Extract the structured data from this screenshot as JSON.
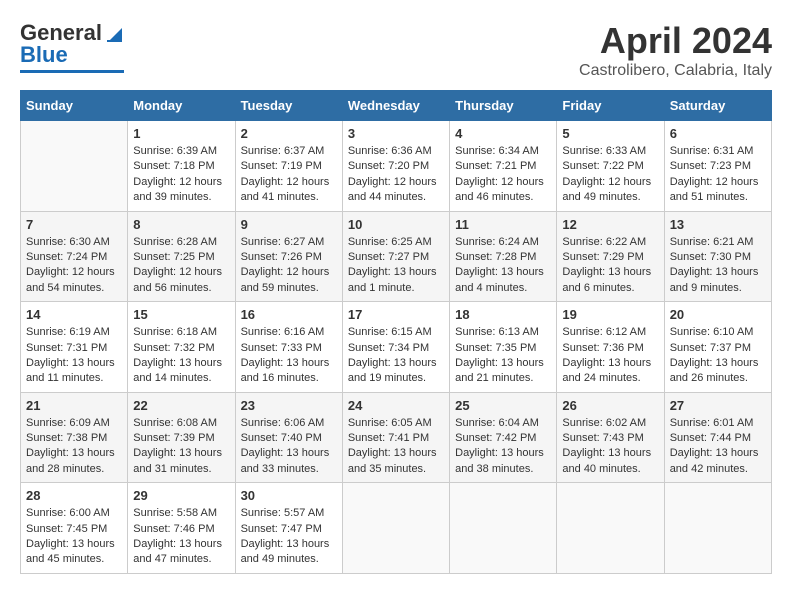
{
  "logo": {
    "part1": "General",
    "part2": "Blue"
  },
  "title": "April 2024",
  "subtitle": "Castrolibero, Calabria, Italy",
  "days_of_week": [
    "Sunday",
    "Monday",
    "Tuesday",
    "Wednesday",
    "Thursday",
    "Friday",
    "Saturday"
  ],
  "weeks": [
    [
      {
        "day": "",
        "info": ""
      },
      {
        "day": "1",
        "info": "Sunrise: 6:39 AM\nSunset: 7:18 PM\nDaylight: 12 hours\nand 39 minutes."
      },
      {
        "day": "2",
        "info": "Sunrise: 6:37 AM\nSunset: 7:19 PM\nDaylight: 12 hours\nand 41 minutes."
      },
      {
        "day": "3",
        "info": "Sunrise: 6:36 AM\nSunset: 7:20 PM\nDaylight: 12 hours\nand 44 minutes."
      },
      {
        "day": "4",
        "info": "Sunrise: 6:34 AM\nSunset: 7:21 PM\nDaylight: 12 hours\nand 46 minutes."
      },
      {
        "day": "5",
        "info": "Sunrise: 6:33 AM\nSunset: 7:22 PM\nDaylight: 12 hours\nand 49 minutes."
      },
      {
        "day": "6",
        "info": "Sunrise: 6:31 AM\nSunset: 7:23 PM\nDaylight: 12 hours\nand 51 minutes."
      }
    ],
    [
      {
        "day": "7",
        "info": "Sunrise: 6:30 AM\nSunset: 7:24 PM\nDaylight: 12 hours\nand 54 minutes."
      },
      {
        "day": "8",
        "info": "Sunrise: 6:28 AM\nSunset: 7:25 PM\nDaylight: 12 hours\nand 56 minutes."
      },
      {
        "day": "9",
        "info": "Sunrise: 6:27 AM\nSunset: 7:26 PM\nDaylight: 12 hours\nand 59 minutes."
      },
      {
        "day": "10",
        "info": "Sunrise: 6:25 AM\nSunset: 7:27 PM\nDaylight: 13 hours\nand 1 minute."
      },
      {
        "day": "11",
        "info": "Sunrise: 6:24 AM\nSunset: 7:28 PM\nDaylight: 13 hours\nand 4 minutes."
      },
      {
        "day": "12",
        "info": "Sunrise: 6:22 AM\nSunset: 7:29 PM\nDaylight: 13 hours\nand 6 minutes."
      },
      {
        "day": "13",
        "info": "Sunrise: 6:21 AM\nSunset: 7:30 PM\nDaylight: 13 hours\nand 9 minutes."
      }
    ],
    [
      {
        "day": "14",
        "info": "Sunrise: 6:19 AM\nSunset: 7:31 PM\nDaylight: 13 hours\nand 11 minutes."
      },
      {
        "day": "15",
        "info": "Sunrise: 6:18 AM\nSunset: 7:32 PM\nDaylight: 13 hours\nand 14 minutes."
      },
      {
        "day": "16",
        "info": "Sunrise: 6:16 AM\nSunset: 7:33 PM\nDaylight: 13 hours\nand 16 minutes."
      },
      {
        "day": "17",
        "info": "Sunrise: 6:15 AM\nSunset: 7:34 PM\nDaylight: 13 hours\nand 19 minutes."
      },
      {
        "day": "18",
        "info": "Sunrise: 6:13 AM\nSunset: 7:35 PM\nDaylight: 13 hours\nand 21 minutes."
      },
      {
        "day": "19",
        "info": "Sunrise: 6:12 AM\nSunset: 7:36 PM\nDaylight: 13 hours\nand 24 minutes."
      },
      {
        "day": "20",
        "info": "Sunrise: 6:10 AM\nSunset: 7:37 PM\nDaylight: 13 hours\nand 26 minutes."
      }
    ],
    [
      {
        "day": "21",
        "info": "Sunrise: 6:09 AM\nSunset: 7:38 PM\nDaylight: 13 hours\nand 28 minutes."
      },
      {
        "day": "22",
        "info": "Sunrise: 6:08 AM\nSunset: 7:39 PM\nDaylight: 13 hours\nand 31 minutes."
      },
      {
        "day": "23",
        "info": "Sunrise: 6:06 AM\nSunset: 7:40 PM\nDaylight: 13 hours\nand 33 minutes."
      },
      {
        "day": "24",
        "info": "Sunrise: 6:05 AM\nSunset: 7:41 PM\nDaylight: 13 hours\nand 35 minutes."
      },
      {
        "day": "25",
        "info": "Sunrise: 6:04 AM\nSunset: 7:42 PM\nDaylight: 13 hours\nand 38 minutes."
      },
      {
        "day": "26",
        "info": "Sunrise: 6:02 AM\nSunset: 7:43 PM\nDaylight: 13 hours\nand 40 minutes."
      },
      {
        "day": "27",
        "info": "Sunrise: 6:01 AM\nSunset: 7:44 PM\nDaylight: 13 hours\nand 42 minutes."
      }
    ],
    [
      {
        "day": "28",
        "info": "Sunrise: 6:00 AM\nSunset: 7:45 PM\nDaylight: 13 hours\nand 45 minutes."
      },
      {
        "day": "29",
        "info": "Sunrise: 5:58 AM\nSunset: 7:46 PM\nDaylight: 13 hours\nand 47 minutes."
      },
      {
        "day": "30",
        "info": "Sunrise: 5:57 AM\nSunset: 7:47 PM\nDaylight: 13 hours\nand 49 minutes."
      },
      {
        "day": "",
        "info": ""
      },
      {
        "day": "",
        "info": ""
      },
      {
        "day": "",
        "info": ""
      },
      {
        "day": "",
        "info": ""
      }
    ]
  ]
}
